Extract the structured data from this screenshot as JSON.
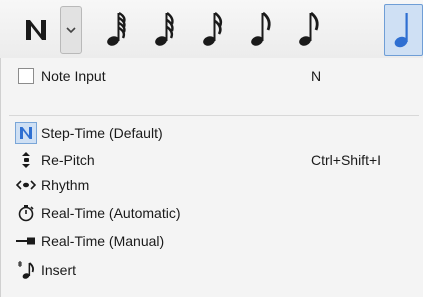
{
  "toolbar": {
    "mode_icon": "note-input-n-icon",
    "dropdown_icon": "chevron-down-icon",
    "durations": [
      {
        "icon": "64th-note-icon"
      },
      {
        "icon": "32nd-note-icon"
      },
      {
        "icon": "16th-note-icon"
      },
      {
        "icon": "eighth-note-icon"
      },
      {
        "icon": "eighth-note-icon"
      },
      {
        "icon": "quarter-note-icon",
        "active": true
      }
    ],
    "accent_color": "#2f6fd1"
  },
  "menu": {
    "note_input": {
      "label": "Note Input",
      "shortcut": "N",
      "checked": false
    },
    "items": [
      {
        "icon": "step-time-n-icon",
        "label": "Step-Time (Default)",
        "shortcut": "",
        "selected": true
      },
      {
        "icon": "re-pitch-icon",
        "label": "Re-Pitch",
        "shortcut": "Ctrl+Shift+I",
        "selected": false
      },
      {
        "icon": "rhythm-icon",
        "label": "Rhythm",
        "shortcut": "",
        "selected": false
      },
      {
        "icon": "stopwatch-icon",
        "label": "Real-Time (Automatic)",
        "shortcut": "",
        "selected": false
      },
      {
        "icon": "real-time-manual-icon",
        "label": "Real-Time (Manual)",
        "shortcut": "",
        "selected": false
      },
      {
        "icon": "insert-note-icon",
        "label": "Insert",
        "shortcut": "",
        "selected": false
      }
    ]
  }
}
